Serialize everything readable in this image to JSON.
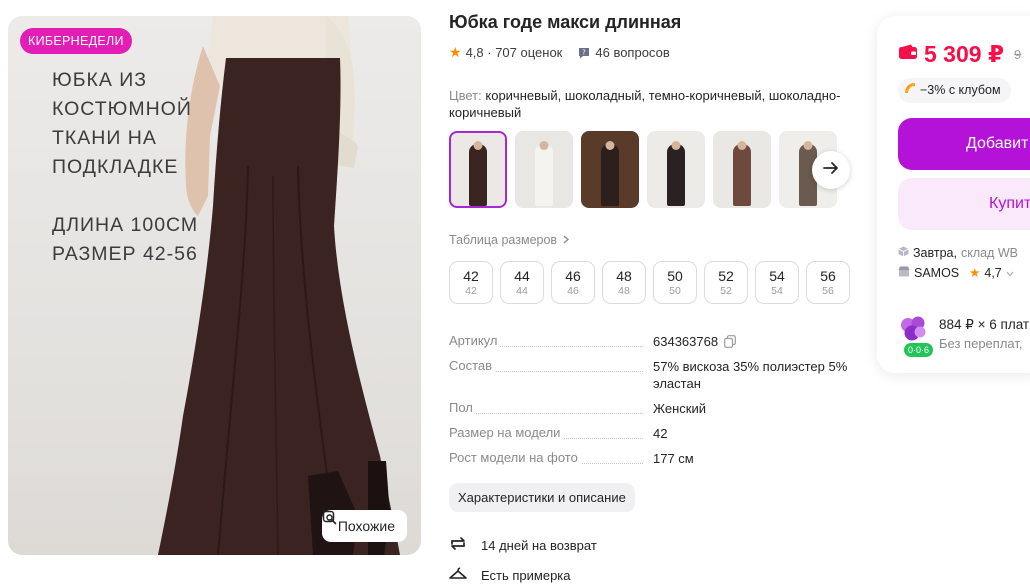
{
  "colors": {
    "accent": "#a726d6",
    "button": "#b512d9",
    "price": "#f5104a",
    "promo": "#e21eb5",
    "star": "#ff8b00",
    "installment_badge": "#23c55a"
  },
  "photo": {
    "promo_badge": "КИБЕРНЕДЕЛИ",
    "overlay_lines": [
      "ЮБКА ИЗ",
      "КОСТЮМНОЙ",
      "ТКАНИ НА",
      "ПОДКЛАДКЕ",
      "ДЛИНА 100СМ",
      "РАЗМЕР 42-56"
    ],
    "similar_label": "Похожие",
    "similar_icon": "search-similar-icon"
  },
  "product": {
    "title": "Юбка годе макси длинная",
    "rating": "4,8",
    "reviews": "· 707 оценок",
    "questions": "46 вопросов",
    "color_label": "Цвет:",
    "color_value": "коричневый, шоколадный, темно-коричневый, шоколадно-коричневый"
  },
  "thumbnails": [
    {
      "active": true,
      "bg": "#ebe8e5",
      "fig": "#3a2422"
    },
    {
      "active": false,
      "bg": "#e8e7e4",
      "fig": "#f4f3ef"
    },
    {
      "active": false,
      "bg": "#5a3b2a",
      "fig": "#2d1f1c"
    },
    {
      "active": false,
      "bg": "#ecebe8",
      "fig": "#2a2222"
    },
    {
      "active": false,
      "bg": "#eae8e4",
      "fig": "#6e4a3e"
    },
    {
      "active": false,
      "bg": "#efeeeb",
      "fig": "#6a5a50"
    }
  ],
  "size_table_label": "Таблица размеров",
  "sizes": [
    {
      "main": "42",
      "sub": "42"
    },
    {
      "main": "44",
      "sub": "44"
    },
    {
      "main": "46",
      "sub": "46"
    },
    {
      "main": "48",
      "sub": "48"
    },
    {
      "main": "50",
      "sub": "50"
    },
    {
      "main": "52",
      "sub": "52"
    },
    {
      "main": "54",
      "sub": "54"
    },
    {
      "main": "56",
      "sub": "56"
    }
  ],
  "specs": {
    "article_label": "Артикул",
    "article_value": "634363768",
    "composition_label": "Состав",
    "composition_value": "57% вискоза 35% полиэстер 5% эластан",
    "gender_label": "Пол",
    "gender_value": "Женский",
    "model_size_label": "Размер на модели",
    "model_size_value": "42",
    "model_height_label": "Рост модели на фото",
    "model_height_value": "177 см"
  },
  "characteristics_button": "Характеристики и описание",
  "features": {
    "return": "14 дней на возврат",
    "fitting": "Есть примерка"
  },
  "buy_card": {
    "price": "5 309 ₽",
    "old_price": "9",
    "club": "−3% с клубом",
    "add_label": "Добавит",
    "buy_label": "Купит",
    "delivery_day": "Завтра,",
    "delivery_where": "склад WB",
    "seller": "SAMOS",
    "seller_rating": "4,7",
    "installment": "884 ₽ × 6 плат",
    "installment_sub": "Без переплат,",
    "installment_badge": "0·0·6"
  }
}
